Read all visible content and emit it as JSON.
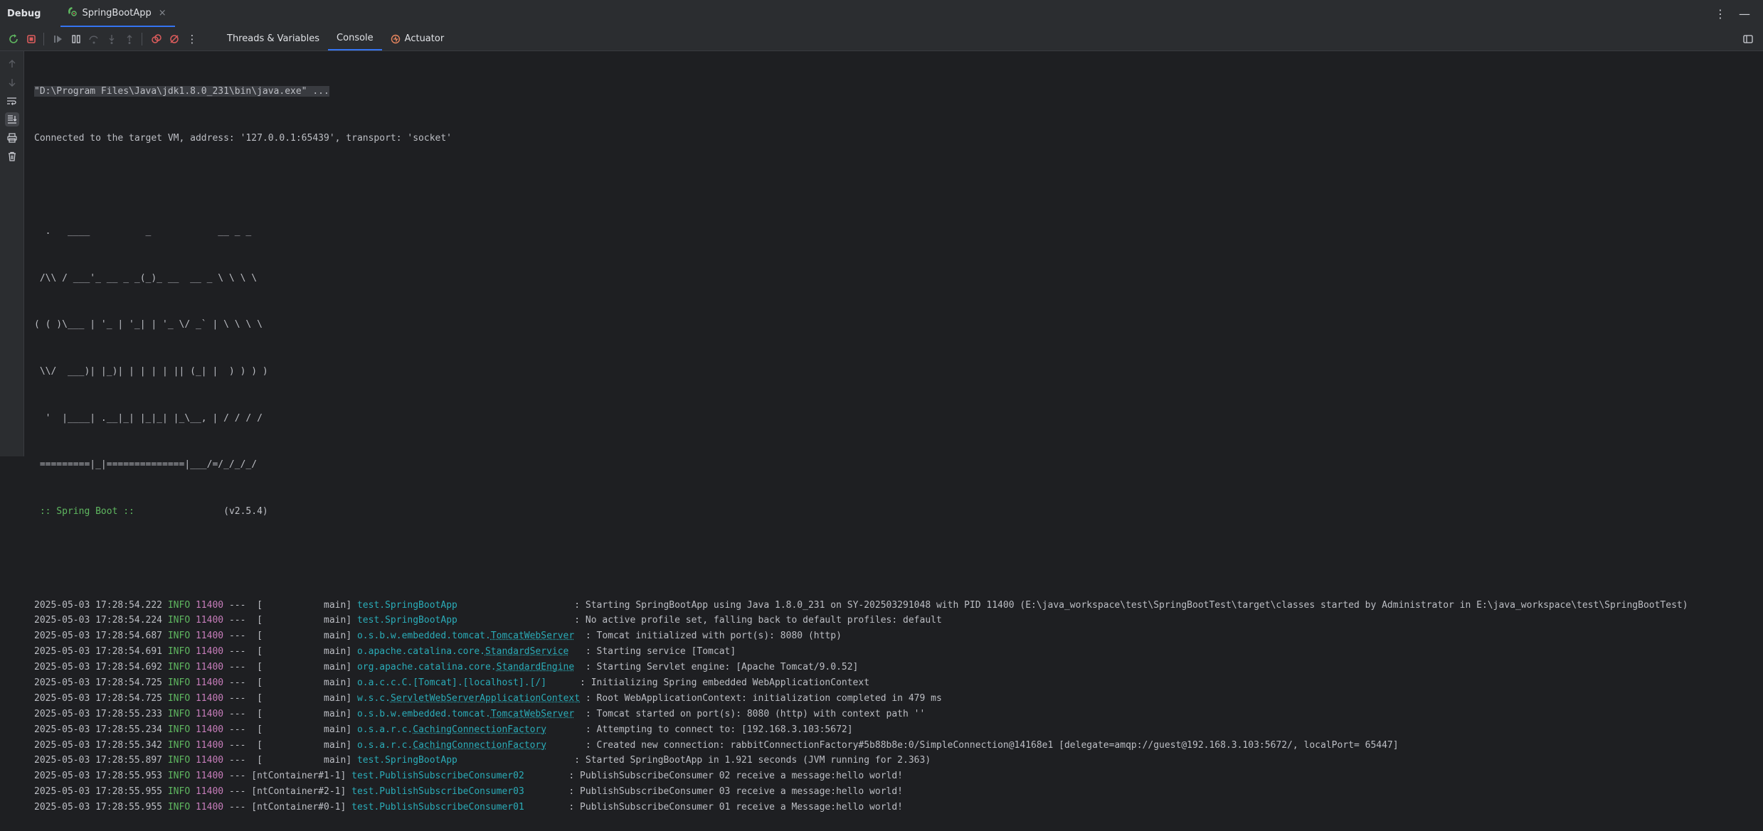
{
  "titlebar": {
    "title": "Debug",
    "tab_name": "SpringBootApp",
    "tab_close": "×",
    "more": "⋮",
    "minimize": "—"
  },
  "toolbar": {
    "tabs": [
      "Threads & Variables",
      "Console",
      "Actuator"
    ],
    "active_tab": "Console"
  },
  "console": {
    "cmd": "\"D:\\Program Files\\Java\\jdk1.8.0_231\\bin\\java.exe\" ...",
    "connected": "Connected to the target VM, address: '127.0.0.1:65439', transport: 'socket'",
    "banner": [
      "  .   ____          _            __ _ _",
      " /\\\\ / ___'_ __ _ _(_)_ __  __ _ \\ \\ \\ \\",
      "( ( )\\___ | '_ | '_| | '_ \\/ _` | \\ \\ \\ \\",
      " \\\\/  ___)| |_)| | | | | || (_| |  ) ) ) )",
      "  '  |____| .__|_| |_|_| |_\\__, | / / / /",
      " =========|_|==============|___/=/_/_/_/"
    ],
    "spring_boot_label": " :: Spring Boot :: ",
    "spring_boot_version": "               (v2.5.4)",
    "logs": [
      {
        "ts": "2025-05-03 17:28:54.222",
        "lvl": "INFO",
        "pid": "11400",
        "thread": "---  [           main] ",
        "logger_pre": "test.SpringBootApp",
        "logger_ul": "",
        "pad": "                     ",
        "msg": ": Starting SpringBootApp using Java 1.8.0_231 on SY-202503291048 with PID 11400 (E:\\java_workspace\\test\\SpringBootTest\\target\\classes started by Administrator in E:\\java_workspace\\test\\SpringBootTest)"
      },
      {
        "ts": "2025-05-03 17:28:54.224",
        "lvl": "INFO",
        "pid": "11400",
        "thread": "---  [           main] ",
        "logger_pre": "test.SpringBootApp",
        "logger_ul": "",
        "pad": "                     ",
        "msg": ": No active profile set, falling back to default profiles: default"
      },
      {
        "ts": "2025-05-03 17:28:54.687",
        "lvl": "INFO",
        "pid": "11400",
        "thread": "---  [           main] ",
        "logger_pre": "o.s.b.w.embedded.tomcat.",
        "logger_ul": "TomcatWebServer",
        "pad": "  ",
        "msg": ": Tomcat initialized with port(s): 8080 (http)"
      },
      {
        "ts": "2025-05-03 17:28:54.691",
        "lvl": "INFO",
        "pid": "11400",
        "thread": "---  [           main] ",
        "logger_pre": "o.apache.catalina.core.",
        "logger_ul": "StandardService",
        "pad": "   ",
        "msg": ": Starting service [Tomcat]"
      },
      {
        "ts": "2025-05-03 17:28:54.692",
        "lvl": "INFO",
        "pid": "11400",
        "thread": "---  [           main] ",
        "logger_pre": "org.apache.catalina.core.",
        "logger_ul": "StandardEngine",
        "pad": "  ",
        "msg": ": Starting Servlet engine: [Apache Tomcat/9.0.52]"
      },
      {
        "ts": "2025-05-03 17:28:54.725",
        "lvl": "INFO",
        "pid": "11400",
        "thread": "---  [           main] ",
        "logger_pre": "o.a.c.c.C.[Tomcat].[localhost].[/]",
        "logger_ul": "",
        "pad": "      ",
        "msg": ": Initializing Spring embedded WebApplicationContext"
      },
      {
        "ts": "2025-05-03 17:28:54.725",
        "lvl": "INFO",
        "pid": "11400",
        "thread": "---  [           main] ",
        "logger_pre": "w.s.c.",
        "logger_ul": "ServletWebServerApplicationContext",
        "pad": " ",
        "msg": ": Root WebApplicationContext: initialization completed in 479 ms"
      },
      {
        "ts": "2025-05-03 17:28:55.233",
        "lvl": "INFO",
        "pid": "11400",
        "thread": "---  [           main] ",
        "logger_pre": "o.s.b.w.embedded.tomcat.",
        "logger_ul": "TomcatWebServer",
        "pad": "  ",
        "msg": ": Tomcat started on port(s): 8080 (http) with context path ''"
      },
      {
        "ts": "2025-05-03 17:28:55.234",
        "lvl": "INFO",
        "pid": "11400",
        "thread": "---  [           main] ",
        "logger_pre": "o.s.a.r.c.",
        "logger_ul": "CachingConnectionFactory",
        "pad": "       ",
        "msg": ": Attempting to connect to: [192.168.3.103:5672]"
      },
      {
        "ts": "2025-05-03 17:28:55.342",
        "lvl": "INFO",
        "pid": "11400",
        "thread": "---  [           main] ",
        "logger_pre": "o.s.a.r.c.",
        "logger_ul": "CachingConnectionFactory",
        "pad": "       ",
        "msg": ": Created new connection: rabbitConnectionFactory#5b88b8e:0/SimpleConnection@14168e1 [delegate=amqp://guest@192.168.3.103:5672/, localPort= 65447]"
      },
      {
        "ts": "2025-05-03 17:28:55.897",
        "lvl": "INFO",
        "pid": "11400",
        "thread": "---  [           main] ",
        "logger_pre": "test.SpringBootApp",
        "logger_ul": "",
        "pad": "                     ",
        "msg": ": Started SpringBootApp in 1.921 seconds (JVM running for 2.363)"
      },
      {
        "ts": "2025-05-03 17:28:55.953",
        "lvl": "INFO",
        "pid": "11400",
        "thread": "--- [ntContainer#1-1] ",
        "logger_pre": "test.PublishSubscribeConsumer02",
        "logger_ul": "",
        "pad": "        ",
        "msg": ": PublishSubscribeConsumer 02 receive a message:hello world!"
      },
      {
        "ts": "2025-05-03 17:28:55.955",
        "lvl": "INFO",
        "pid": "11400",
        "thread": "--- [ntContainer#2-1] ",
        "logger_pre": "test.PublishSubscribeConsumer03",
        "logger_ul": "",
        "pad": "        ",
        "msg": ": PublishSubscribeConsumer 03 receive a message:hello world!"
      },
      {
        "ts": "2025-05-03 17:28:55.955",
        "lvl": "INFO",
        "pid": "11400",
        "thread": "--- [ntContainer#0-1] ",
        "logger_pre": "test.PublishSubscribeConsumer01",
        "logger_ul": "",
        "pad": "        ",
        "msg": ": PublishSubscribeConsumer 01 receive a Message:hello world!"
      }
    ]
  },
  "colors": {
    "accent": "#3574f0",
    "info_green": "#5fb760",
    "pid_purple": "#c77dbb",
    "logger_cyan": "#2aacb8",
    "stop_red": "#db5c5c"
  }
}
